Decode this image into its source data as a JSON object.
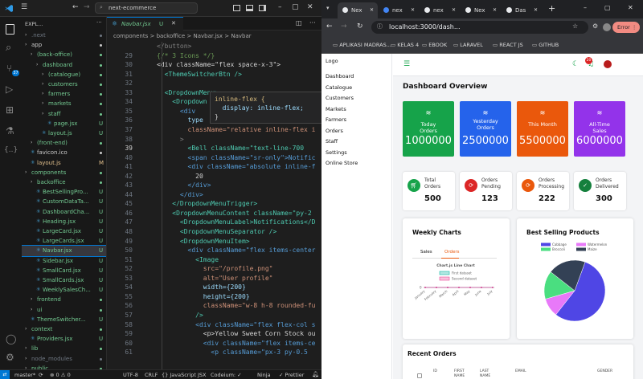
{
  "vscode": {
    "search_placeholder": "next-ecommerce",
    "explorer_label": "EXPL...",
    "tree": [
      {
        "label": ".next",
        "d": 1,
        "c": "#6e7681"
      },
      {
        "label": "app",
        "d": 1,
        "c": "#cccccc"
      },
      {
        "label": "(back-office)",
        "d": 2,
        "c": "#73c991"
      },
      {
        "label": "dashboard",
        "d": 3,
        "c": "#73c991"
      },
      {
        "label": "(catalogue)",
        "d": 4,
        "c": "#73c991"
      },
      {
        "label": "customers",
        "d": 4,
        "c": "#73c991"
      },
      {
        "label": "farmers",
        "d": 4,
        "c": "#73c991"
      },
      {
        "label": "markets",
        "d": 4,
        "c": "#73c991"
      },
      {
        "label": "staff",
        "d": 4,
        "c": "#73c991"
      },
      {
        "label": "page.jsx",
        "d": 5,
        "c": "#73c991",
        "b": "U"
      },
      {
        "label": "layout.js",
        "d": 4,
        "c": "#73c991",
        "b": "U"
      },
      {
        "label": "(front-end)",
        "d": 2,
        "c": "#73c991"
      },
      {
        "label": "favicon.ico",
        "d": 2,
        "c": "#cccccc"
      },
      {
        "label": "layout.js",
        "d": 2,
        "c": "#e2c08d",
        "b": "M"
      },
      {
        "label": "components",
        "d": 1,
        "c": "#73c991"
      },
      {
        "label": "backoffice",
        "d": 2,
        "c": "#73c991"
      },
      {
        "label": "BestSellingPro...",
        "d": 3,
        "c": "#73c991",
        "b": "U"
      },
      {
        "label": "CustomDataTa...",
        "d": 3,
        "c": "#73c991",
        "b": "U"
      },
      {
        "label": "DashboardCha...",
        "d": 3,
        "c": "#73c991",
        "b": "U"
      },
      {
        "label": "Heading.jsx",
        "d": 3,
        "c": "#73c991",
        "b": "U"
      },
      {
        "label": "LargeCard.jsx",
        "d": 3,
        "c": "#73c991",
        "b": "U"
      },
      {
        "label": "LargeCards.jsx",
        "d": 3,
        "c": "#73c991",
        "b": "U"
      },
      {
        "label": "Navbar.jsx",
        "d": 3,
        "c": "#73c991",
        "b": "U",
        "sel": true
      },
      {
        "label": "Sidebar.jsx",
        "d": 3,
        "c": "#73c991",
        "b": "U"
      },
      {
        "label": "SmallCard.jsx",
        "d": 3,
        "c": "#73c991",
        "b": "U"
      },
      {
        "label": "SmallCards.jsx",
        "d": 3,
        "c": "#73c991",
        "b": "U"
      },
      {
        "label": "WeeklySalesCh...",
        "d": 3,
        "c": "#73c991",
        "b": "U"
      },
      {
        "label": "frontend",
        "d": 2,
        "c": "#73c991"
      },
      {
        "label": "ui",
        "d": 2,
        "c": "#73c991"
      },
      {
        "label": "ThemeSwitcher...",
        "d": 2,
        "c": "#73c991",
        "b": "U"
      },
      {
        "label": "context",
        "d": 1,
        "c": "#73c991"
      },
      {
        "label": "Providers.jsx",
        "d": 2,
        "c": "#73c991",
        "b": "U"
      },
      {
        "label": "lib",
        "d": 1,
        "c": "#73c991"
      },
      {
        "label": "node_modules",
        "d": 1,
        "c": "#6e7681"
      },
      {
        "label": "public",
        "d": 1,
        "c": "#73c991"
      }
    ],
    "tab": "Navbar.jsx",
    "tab_badge": "U",
    "breadcrumb": "components  >  backoffice  >  Navbar.jsx  >  Navbar",
    "code": [
      {
        "n": "",
        "t": "</button>",
        "c": "#808080"
      },
      {
        "n": "29",
        "t": "{/* 3 Icons */}",
        "c": "#6a9955"
      },
      {
        "n": "30",
        "t": "<div className=\"flex space-x-3\">",
        "c": "#d4d4d4"
      },
      {
        "n": "31",
        "t": "  <ThemeSwitcherBtn />",
        "c": "#4ec9b0"
      },
      {
        "n": "32",
        "t": "",
        "c": "#d4d4d4"
      },
      {
        "n": "33",
        "t": "  <DropdownMenu>",
        "c": "#4ec9b0"
      },
      {
        "n": "34",
        "t": "    <Dropdown",
        "c": "#4ec9b0"
      },
      {
        "n": "35",
        "t": "      <div",
        "c": "#569cd6"
      },
      {
        "n": "36",
        "t": "        type",
        "c": "#9cdcfe"
      },
      {
        "n": "37",
        "t": "        className=\"relative inline-flex i",
        "c": "#ce9178"
      },
      {
        "n": "38",
        "t": "      >",
        "c": "#808080"
      },
      {
        "n": "39",
        "t": "        <Bell className=\"text-line-700",
        "c": "#4ec9b0"
      },
      {
        "n": "40",
        "t": "        <span className=\"sr-only\">Notific",
        "c": "#569cd6"
      },
      {
        "n": "41",
        "t": "        <div className=\"absolute inline-f",
        "c": "#569cd6"
      },
      {
        "n": "42",
        "t": "          20",
        "c": "#d4d4d4"
      },
      {
        "n": "43",
        "t": "        </div>",
        "c": "#569cd6"
      },
      {
        "n": "44",
        "t": "      </div>",
        "c": "#569cd6"
      },
      {
        "n": "45",
        "t": "    </DropdownMenuTrigger>",
        "c": "#4ec9b0"
      },
      {
        "n": "46",
        "t": "    <DropdownMenuContent className=\"py-2",
        "c": "#4ec9b0"
      },
      {
        "n": "47",
        "t": "      <DropdownMenuLabel>Notifications</D",
        "c": "#4ec9b0"
      },
      {
        "n": "48",
        "t": "      <DropdownMenuSeparator />",
        "c": "#4ec9b0"
      },
      {
        "n": "49",
        "t": "      <DropdownMenuItem>",
        "c": "#4ec9b0"
      },
      {
        "n": "50",
        "t": "        <div className=\"flex items-center",
        "c": "#569cd6"
      },
      {
        "n": "51",
        "t": "          <Image",
        "c": "#4ec9b0"
      },
      {
        "n": "52",
        "t": "            src=\"/profile.png\"",
        "c": "#ce9178"
      },
      {
        "n": "53",
        "t": "            alt=\"User profile\"",
        "c": "#ce9178"
      },
      {
        "n": "54",
        "t": "            width={200}",
        "c": "#9cdcfe"
      },
      {
        "n": "55",
        "t": "            height={200}",
        "c": "#9cdcfe"
      },
      {
        "n": "56",
        "t": "            className=\"w-8 h-8 rounded-fu",
        "c": "#ce9178"
      },
      {
        "n": "57",
        "t": "          />",
        "c": "#4ec9b0"
      },
      {
        "n": "58",
        "t": "          <div className=\"flex flex-col s",
        "c": "#569cd6"
      },
      {
        "n": "59",
        "t": "            <p>Yellow Sweet Corn Stock ou",
        "c": "#d4d4d4"
      },
      {
        "n": "60",
        "t": "            <div className=\"flex items-ce",
        "c": "#569cd6"
      },
      {
        "n": "61",
        "t": "              <p className=\"px-3 py-0.5",
        "c": "#569cd6"
      }
    ],
    "hover_lines": [
      "inline-flex {",
      "  display: inline-flex;",
      "}"
    ],
    "status": {
      "branch": "master*",
      "sync": "⟳",
      "errors": "⊗ 0 ⚠ 0",
      "enc": "UTF-8",
      "eol": "CRLF",
      "lang": "{} JavaScript JSX",
      "cod": "Codeium: ✓",
      "ninja": "Ninja",
      "prettier": "✓ Prettier"
    }
  },
  "browser": {
    "tabs": [
      "Nex",
      "nex",
      "nex",
      "Nex",
      "Das"
    ],
    "tab_colors": [
      "#e8eaed",
      "#4285f4",
      "#e8eaed",
      "#e8eaed",
      "#e8eaed"
    ],
    "url": "localhost:3000/dash...",
    "error_label": "Error",
    "bookmarks": [
      "APLIKASI MADRAS...",
      "KELAS 4",
      "EBOOK",
      "LARAVEL",
      "REACT JS",
      "GITHUB"
    ]
  },
  "app": {
    "sidebar": [
      "Logo",
      "Dashboard",
      "Catalogue",
      "Customers",
      "Markets",
      "Farmers",
      "Orders",
      "Staff",
      "Settings",
      "Online Store"
    ],
    "badge": "20",
    "title": "Dashboard Overview",
    "large_cards": [
      {
        "label": "Today Orders",
        "value": "1000000",
        "color": "#16a34a"
      },
      {
        "label": "Yesterday Orders",
        "value": "2500000",
        "color": "#2563eb"
      },
      {
        "label": "This Month",
        "value": "5500000",
        "color": "#ea580c"
      },
      {
        "label": "All-Time Sales",
        "value": "6000000",
        "color": "#9333ea"
      }
    ],
    "small_cards": [
      {
        "label": "Total Orders",
        "value": "500",
        "color": "#16a34a"
      },
      {
        "label": "Orders Pending",
        "value": "123",
        "color": "#dc2626"
      },
      {
        "label": "Orders Processing",
        "value": "222",
        "color": "#ea580c"
      },
      {
        "label": "Orders Delivered",
        "value": "300",
        "color": "#15803d"
      }
    ],
    "weekly": {
      "title": "Weekly Charts",
      "tabs": [
        "Sales",
        "Orders"
      ],
      "chart_title": "Chart.js Line Chart",
      "legend": [
        "First dataset",
        "Second dataset"
      ],
      "labels": [
        "January",
        "February",
        "March",
        "April",
        "May",
        "June",
        "July"
      ]
    },
    "best": {
      "title": "Best Selling Products",
      "legend": [
        "Cabbage",
        "Watermelon",
        "Broccoli",
        "Maize"
      ],
      "colors": [
        "#4f46e5",
        "#e879f9",
        "#4ade80",
        "#334155"
      ]
    },
    "recent": {
      "title": "Recent Orders",
      "cols": [
        "ID",
        "FIRST NAME",
        "LAST NAME",
        "EMAIL",
        "GENDER"
      ]
    }
  },
  "chart_data": [
    {
      "type": "line",
      "title": "Chart.js Line Chart",
      "categories": [
        "January",
        "February",
        "March",
        "April",
        "May",
        "June",
        "July"
      ],
      "series": [
        {
          "name": "First dataset",
          "values": [
            0,
            0,
            0,
            0,
            0,
            0,
            0
          ]
        },
        {
          "name": "Second dataset",
          "values": [
            0,
            0,
            0,
            0,
            0,
            0,
            0
          ]
        }
      ],
      "ylabel": "",
      "xlabel": ""
    },
    {
      "type": "pie",
      "categories": [
        "Cabbage",
        "Watermelon",
        "Broccoli",
        "Maize"
      ],
      "values": [
        55,
        10,
        15,
        20
      ]
    }
  ]
}
